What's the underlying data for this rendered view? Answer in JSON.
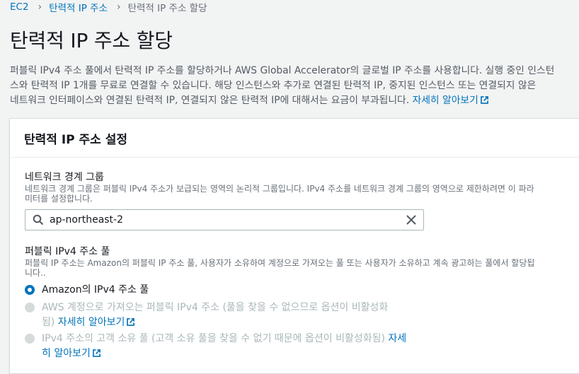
{
  "breadcrumb": {
    "items": [
      "EC2",
      "탄력적 IP 주소"
    ],
    "current": "탄력적 IP 주소 할당"
  },
  "page": {
    "title": "탄력적 IP 주소 할당",
    "description_line1": "퍼블릭 IPv4 주소 풀에서 탄력적 IP 주소를 할당하거나 AWS Global Accelerator의 글로벌 IP 주소를 사용합니다. 실행 중인 인스턴",
    "description_line2": "스와 탄력적 IP 1개를 무료로 연결할 수 있습니다. 해당 인스턴스와 추가로 연결된 탄력적 IP, 중지된 인스턴스 또는 연결되지 않은",
    "description_line3": "네트워크 인터페이스와 연결된 탄력적 IP, 연결되지 않은 탄력적 IP에 대해서는 요금이 부과됩니다.",
    "learn_more": "자세히 알아보기"
  },
  "panel": {
    "title": "탄력적 IP 주소 설정",
    "network_border_group": {
      "label": "네트워크 경계 그룹",
      "description_line1": "네트워크 경계 그룹은 퍼블릭 IPv4 주소가 보급되는 영역의 논리적 그룹입니다. IPv4 주소를 네트워크 경계 그룹의 영역으로 제한하려면 이 파라",
      "description_line2": "미터를 설정합니다.",
      "value": "ap-northeast-2"
    },
    "ipv4_pool": {
      "label": "퍼블릭 IPv4 주소 풀",
      "description_line1": "퍼블릭 IP 주소는 Amazon의 퍼블릭 IP 주소 풀, 사용자가 소유하여 계정으로 가져오는 풀 또는 사용자가 소유하고 계속 광고하는 풀에서 할당됩",
      "description_line2": "니다..",
      "options": [
        {
          "label": "Amazon의 IPv4 주소 풀",
          "state": "checked"
        },
        {
          "label_line1": "AWS 계정으로 가져오는 퍼블릭 IPv4 주소 (풀을 찾을 수 없으므로 옵션이 비활성화",
          "label_line2": "됨)",
          "link": "자세히 알아보기",
          "state": "disabled"
        },
        {
          "label_line1": "IPv4 주소의 고객 소유 풀 (고객 소유 풀을 찾을 수 없기 때문에 옵션이 비활성화됨)",
          "link_part1": "자세",
          "link_part2": "히 알아보기",
          "state": "disabled"
        }
      ]
    }
  },
  "colors": {
    "link": "#0073bb",
    "radio_checked": "#0073bb",
    "disabled_text": "#aab7b8"
  }
}
